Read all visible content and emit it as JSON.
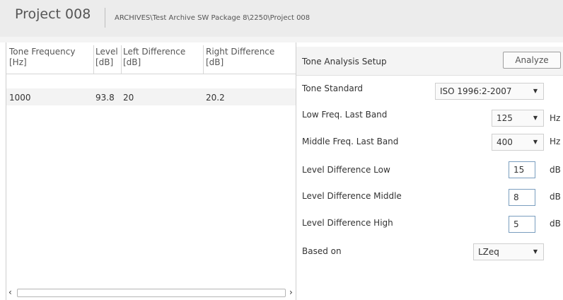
{
  "header": {
    "project_title": "Project 008",
    "path": "ARCHIVES\\Test Archive SW Package 8\\2250\\Project 008"
  },
  "table": {
    "columns": [
      {
        "name": "Tone Frequency",
        "unit": "[Hz]"
      },
      {
        "name": "Level",
        "unit": "[dB]"
      },
      {
        "name": "Left Difference",
        "unit": "[dB]"
      },
      {
        "name": "Right Difference",
        "unit": "[dB]"
      }
    ],
    "rows": [
      [
        "1000",
        "93.8",
        "20",
        "20.2"
      ]
    ],
    "scroll_left": "‹",
    "scroll_right": "›"
  },
  "setup": {
    "title": "Tone Analysis Setup",
    "analyze_label": "Analyze",
    "tone_standard": {
      "label": "Tone Standard",
      "value": "ISO 1996:2-2007"
    },
    "low_freq": {
      "label": "Low Freq. Last Band",
      "value": "125",
      "unit": "Hz"
    },
    "middle_freq": {
      "label": "Middle Freq. Last Band",
      "value": "400",
      "unit": "Hz"
    },
    "level_low": {
      "label": "Level Difference Low",
      "value": "15",
      "unit": "dB"
    },
    "level_middle": {
      "label": "Level Difference Middle",
      "value": "8",
      "unit": "dB"
    },
    "level_high": {
      "label": "Level Difference High",
      "value": "5",
      "unit": "dB"
    },
    "based_on": {
      "label": "Based on",
      "value": "LZeq"
    },
    "caret": "▼"
  }
}
